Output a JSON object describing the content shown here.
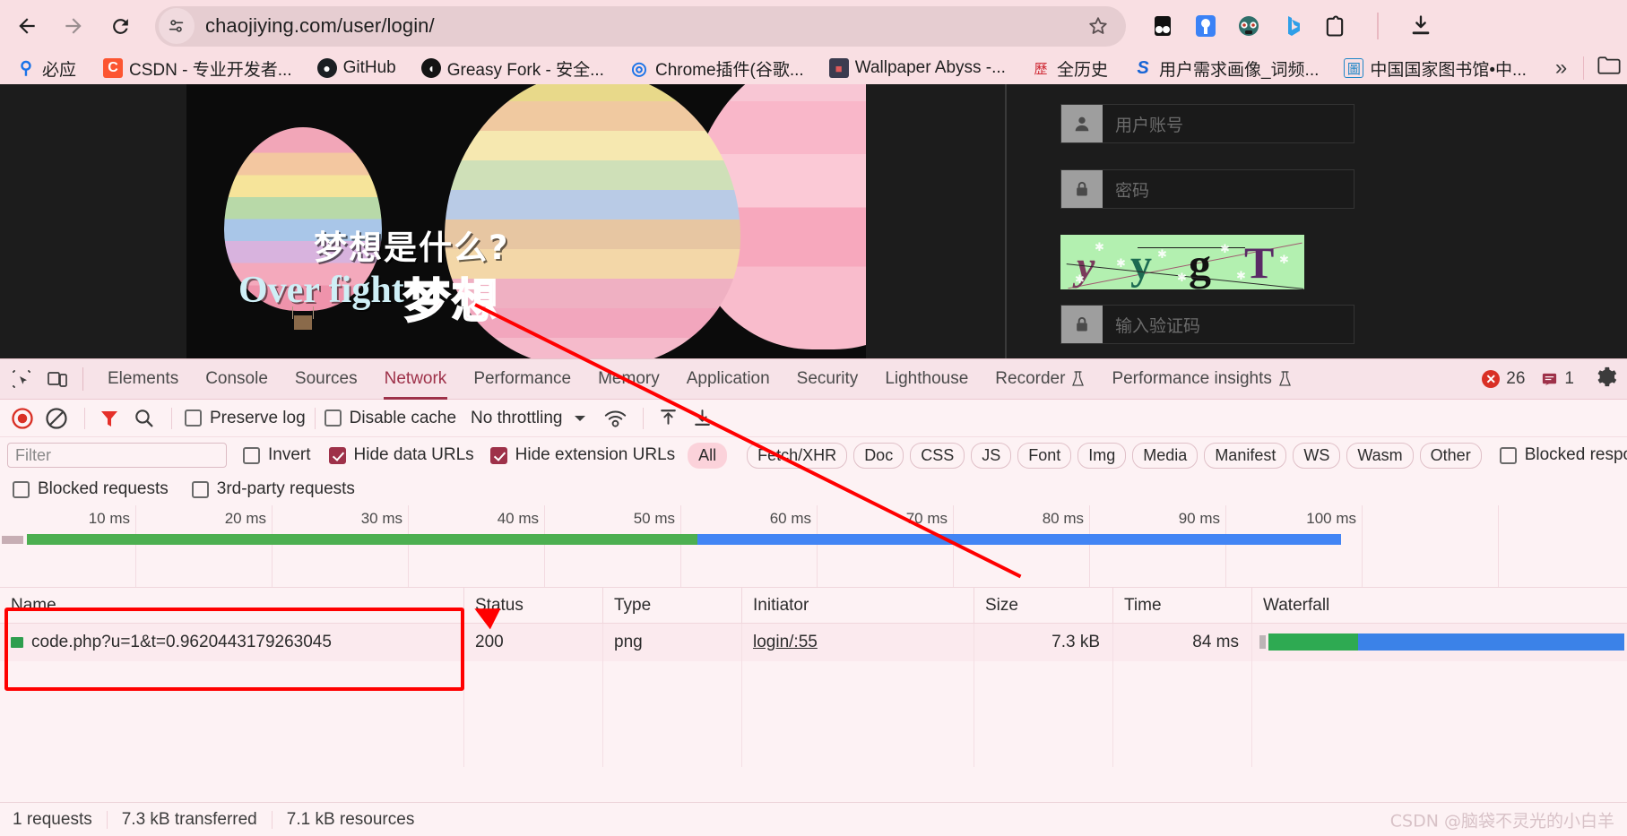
{
  "browser": {
    "back_icon": "arrow-left-icon",
    "forward_icon": "arrow-right-icon",
    "reload_icon": "reload-icon",
    "site_info_icon": "site-settings-icon",
    "url": "chaojiying.com/user/login/",
    "bookmark_star_icon": "star-icon",
    "extensions": [
      {
        "name": "extension-dark-icon",
        "glyph": "◕"
      },
      {
        "name": "extension-bluelight-icon",
        "glyph": "⚲"
      },
      {
        "name": "extension-panda-icon",
        "glyph": "◉"
      },
      {
        "name": "bing-copilot-icon",
        "glyph": "b"
      },
      {
        "name": "extensions-puzzle-icon",
        "glyph": "⬚"
      }
    ],
    "download_icon": "download-icon",
    "bookmarks": [
      {
        "label": "必应",
        "icon": "bing-search-icon",
        "icon_char": "Q",
        "icon_bg": "transparent",
        "icon_color": "#1a73e8"
      },
      {
        "label": "CSDN - 专业开发者...",
        "icon": "csdn-icon",
        "icon_char": "C",
        "icon_bg": "#fc5531",
        "icon_color": "#ffffff"
      },
      {
        "label": "GitHub",
        "icon": "github-icon",
        "icon_char": "●",
        "icon_bg": "#1b1f23",
        "icon_color": "#ffffff"
      },
      {
        "label": "Greasy Fork - 安全...",
        "icon": "greasyfork-icon",
        "icon_char": "◖",
        "icon_bg": "#141414",
        "icon_color": "#ffffff"
      },
      {
        "label": "Chrome插件(谷歌...",
        "icon": "chrome-icon",
        "icon_char": "◎",
        "icon_bg": "transparent",
        "icon_color": "#1a73e8"
      },
      {
        "label": "Wallpaper Abyss -...",
        "icon": "wallpaper-abyss-icon",
        "icon_char": "■",
        "icon_bg": "#3b3b4f",
        "icon_color": "#d9534f"
      },
      {
        "label": "全历史",
        "icon": "quanlishi-icon",
        "icon_char": "歷",
        "icon_bg": "transparent",
        "icon_color": "#cf2b36"
      },
      {
        "label": "用户需求画像_词频...",
        "icon": "sogou-icon",
        "icon_char": "S",
        "icon_bg": "transparent",
        "icon_color": "#1765d6"
      },
      {
        "label": "中国国家图书馆•中...",
        "icon": "nlc-library-icon",
        "icon_char": "圖",
        "icon_bg": "transparent",
        "icon_color": "#1f86c7"
      }
    ],
    "overflow_icon": "chevron-double-right-icon",
    "bookmark_folder_icon": "folder-icon"
  },
  "page": {
    "hero": {
      "text_cn": "梦想是什么?",
      "text_en": "Over fight",
      "text_cn2": "梦想"
    },
    "login": {
      "username_placeholder": "用户账号",
      "username_icon": "user-icon",
      "password_placeholder": "密码",
      "password_icon": "lock-icon",
      "captcha_placeholder": "输入验证码",
      "captcha_icon": "lock-icon",
      "captcha_chars": [
        "y",
        "y",
        "g",
        "T"
      ]
    }
  },
  "devtools": {
    "inspect_icon": "inspect-element-icon",
    "device_toolbar_icon": "device-toolbar-icon",
    "tabs": [
      {
        "label": "Elements",
        "active": false
      },
      {
        "label": "Console",
        "active": false
      },
      {
        "label": "Sources",
        "active": false
      },
      {
        "label": "Network",
        "active": true
      },
      {
        "label": "Performance",
        "active": false
      },
      {
        "label": "Memory",
        "active": false
      },
      {
        "label": "Application",
        "active": false
      },
      {
        "label": "Security",
        "active": false
      },
      {
        "label": "Lighthouse",
        "active": false
      },
      {
        "label": "Recorder",
        "active": false,
        "beaker": true
      },
      {
        "label": "Performance insights",
        "active": false,
        "beaker": true
      }
    ],
    "error_count": "26",
    "error_icon": "error-circle-icon",
    "message_count": "1",
    "message_icon": "message-icon",
    "settings_icon": "gear-icon",
    "toolbar": {
      "record_icon": "record-stop-icon",
      "clear_icon": "clear-icon",
      "filter_icon": "filter-funnel-icon",
      "search_icon": "search-icon",
      "preserve_log_label": "Preserve log",
      "preserve_log_checked": false,
      "disable_cache_label": "Disable cache",
      "disable_cache_checked": false,
      "throttling_value": "No throttling",
      "throttling_caret_icon": "chevron-down-icon",
      "network_conditions_icon": "wifi-settings-icon",
      "import_har_icon": "upload-icon",
      "export_har_icon": "download-icon"
    },
    "filters": {
      "filter_placeholder": "Filter",
      "filter_value": "",
      "invert_label": "Invert",
      "invert_checked": false,
      "hide_data_urls_label": "Hide data URLs",
      "hide_data_urls_checked": true,
      "hide_extension_urls_label": "Hide extension URLs",
      "hide_extension_urls_checked": true,
      "types": [
        {
          "label": "All",
          "active": true
        },
        {
          "label": "Fetch/XHR",
          "active": false
        },
        {
          "label": "Doc",
          "active": false
        },
        {
          "label": "CSS",
          "active": false
        },
        {
          "label": "JS",
          "active": false
        },
        {
          "label": "Font",
          "active": false
        },
        {
          "label": "Img",
          "active": false
        },
        {
          "label": "Media",
          "active": false
        },
        {
          "label": "Manifest",
          "active": false
        },
        {
          "label": "WS",
          "active": false
        },
        {
          "label": "Wasm",
          "active": false
        },
        {
          "label": "Other",
          "active": false
        }
      ],
      "blocked_cookies_label": "Blocked response cookies",
      "blocked_cookies_checked": false,
      "blocked_requests_label": "Blocked requests",
      "blocked_requests_checked": false,
      "third_party_label": "3rd-party requests",
      "third_party_checked": false
    },
    "timeline": {
      "ticks": [
        "10 ms",
        "20 ms",
        "30 ms",
        "40 ms",
        "50 ms",
        "60 ms",
        "70 ms",
        "80 ms",
        "90 ms",
        "100 ms"
      ],
      "green_color": "#4caf50",
      "blue_color": "#4285f4"
    },
    "table": {
      "columns": [
        "Name",
        "Status",
        "Type",
        "Initiator",
        "Size",
        "Time",
        "Waterfall"
      ],
      "rows": [
        {
          "name": "code.php?u=1&t=0.9620443179263045",
          "name_icon": "image-resource-icon",
          "status": "200",
          "type": "png",
          "initiator": "login/:55",
          "size": "7.3 kB",
          "time": "84 ms"
        }
      ]
    },
    "status_bar": {
      "requests": "1 requests",
      "transferred": "7.3 kB transferred",
      "resources": "7.1 kB resources"
    }
  },
  "watermark": "CSDN @脑袋不灵光的小白羊"
}
